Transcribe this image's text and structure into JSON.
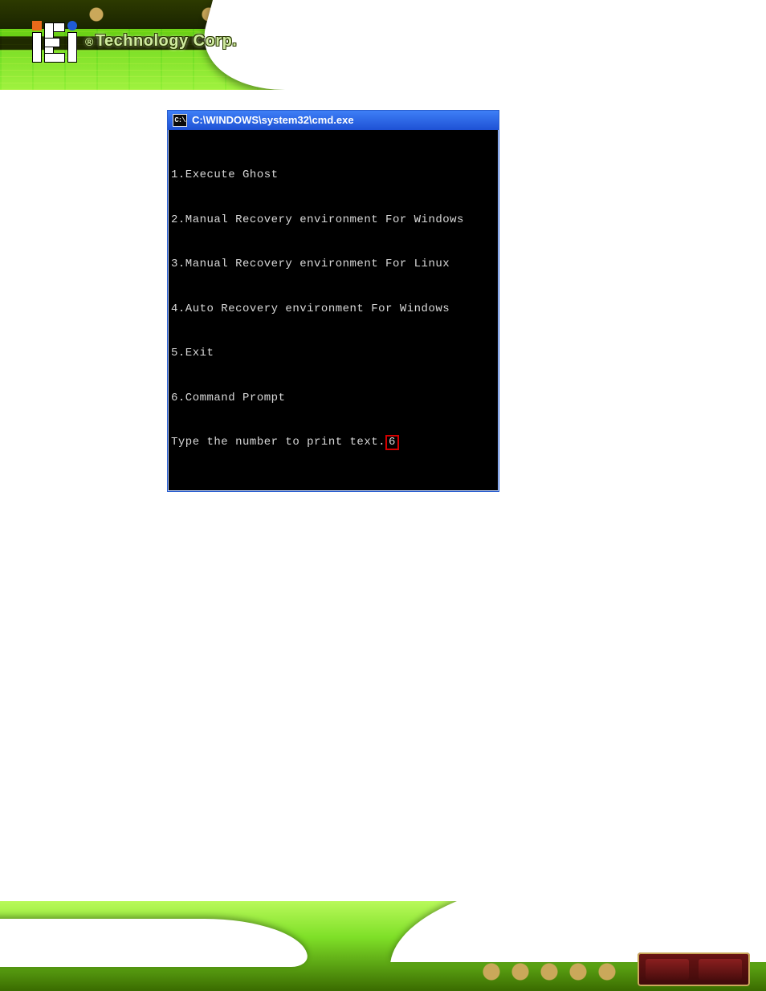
{
  "brand": {
    "name": "Technology Corp."
  },
  "header_icons": {
    "left_logo_letter": "E"
  },
  "terminal": {
    "icon_label": "C:\\",
    "title": "C:\\WINDOWS\\system32\\cmd.exe",
    "menu": [
      "1.Execute Ghost",
      "2.Manual Recovery environment For Windows",
      "3.Manual Recovery environment For Linux",
      "4.Auto Recovery environment For Windows",
      "5.Exit",
      "6.Command Prompt"
    ],
    "prompt": "Type the number to print text.",
    "entered_value": "6"
  }
}
